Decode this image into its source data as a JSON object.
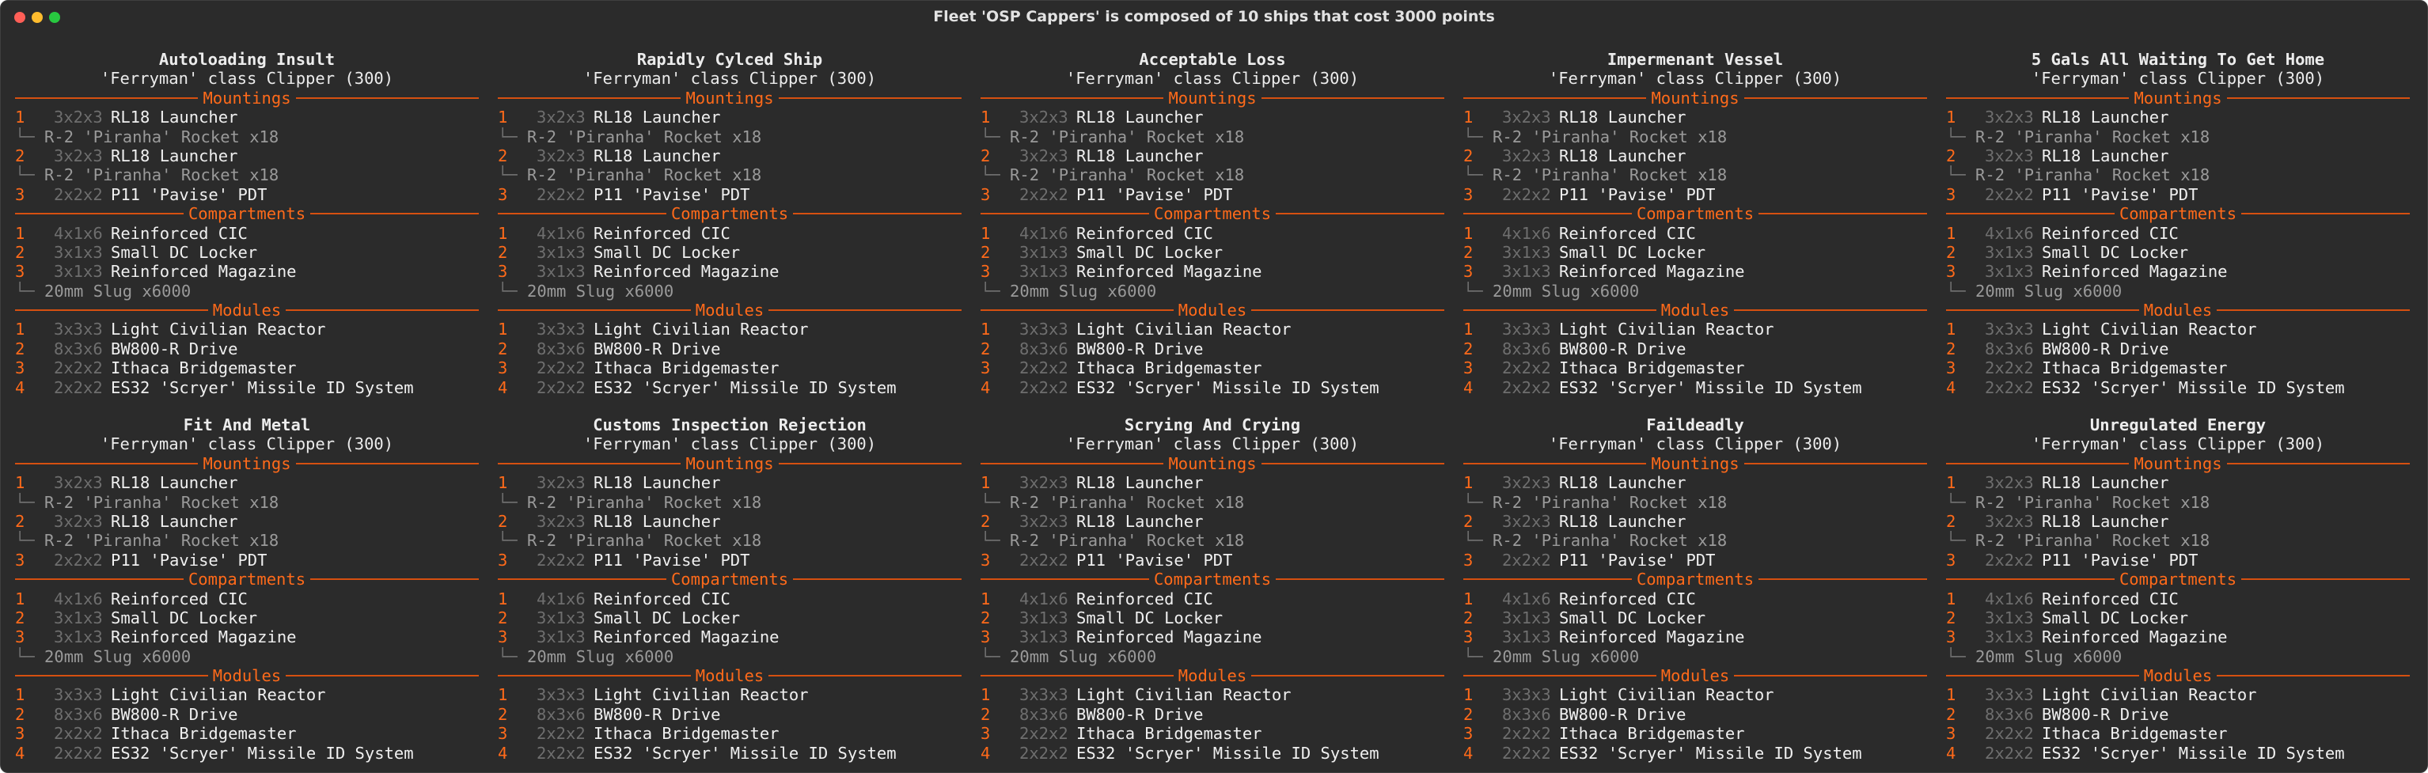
{
  "window": {
    "title": "Fleet 'OSP Cappers' is composed of 10 ships that cost 3000 points"
  },
  "ships": [
    {
      "name": "Autoloading Insult",
      "class": "'Ferryman' class Clipper (300)",
      "mountings_label": "Mountings",
      "mountings": [
        {
          "n": "1",
          "size": "3x2x3",
          "name": "RL18 Launcher",
          "sub": "R-2 'Piranha' Rocket x18"
        },
        {
          "n": "2",
          "size": "3x2x3",
          "name": "RL18 Launcher",
          "sub": "R-2 'Piranha' Rocket x18"
        },
        {
          "n": "3",
          "size": "2x2x2",
          "name": "P11 'Pavise' PDT"
        }
      ],
      "compartments_label": "Compartments",
      "compartments": [
        {
          "n": "1",
          "size": "4x1x6",
          "name": "Reinforced CIC"
        },
        {
          "n": "2",
          "size": "3x1x3",
          "name": "Small DC Locker"
        },
        {
          "n": "3",
          "size": "3x1x3",
          "name": "Reinforced Magazine",
          "sub": "20mm Slug x6000"
        }
      ],
      "modules_label": "Modules",
      "modules": [
        {
          "n": "1",
          "size": "3x3x3",
          "name": "Light Civilian Reactor"
        },
        {
          "n": "2",
          "size": "8x3x6",
          "name": "BW800-R Drive"
        },
        {
          "n": "3",
          "size": "2x2x2",
          "name": "Ithaca Bridgemaster"
        },
        {
          "n": "4",
          "size": "2x2x2",
          "name": "ES32 'Scryer' Missile ID System"
        }
      ]
    },
    {
      "name": "Rapidly Cylced Ship",
      "class": "'Ferryman' class Clipper (300)",
      "mountings_label": "Mountings",
      "mountings": [
        {
          "n": "1",
          "size": "3x2x3",
          "name": "RL18 Launcher",
          "sub": "R-2 'Piranha' Rocket x18"
        },
        {
          "n": "2",
          "size": "3x2x3",
          "name": "RL18 Launcher",
          "sub": "R-2 'Piranha' Rocket x18"
        },
        {
          "n": "3",
          "size": "2x2x2",
          "name": "P11 'Pavise' PDT"
        }
      ],
      "compartments_label": "Compartments",
      "compartments": [
        {
          "n": "1",
          "size": "4x1x6",
          "name": "Reinforced CIC"
        },
        {
          "n": "2",
          "size": "3x1x3",
          "name": "Small DC Locker"
        },
        {
          "n": "3",
          "size": "3x1x3",
          "name": "Reinforced Magazine",
          "sub": "20mm Slug x6000"
        }
      ],
      "modules_label": "Modules",
      "modules": [
        {
          "n": "1",
          "size": "3x3x3",
          "name": "Light Civilian Reactor"
        },
        {
          "n": "2",
          "size": "8x3x6",
          "name": "BW800-R Drive"
        },
        {
          "n": "3",
          "size": "2x2x2",
          "name": "Ithaca Bridgemaster"
        },
        {
          "n": "4",
          "size": "2x2x2",
          "name": "ES32 'Scryer' Missile ID System"
        }
      ]
    },
    {
      "name": "Acceptable Loss",
      "class": "'Ferryman' class Clipper (300)",
      "mountings_label": "Mountings",
      "mountings": [
        {
          "n": "1",
          "size": "3x2x3",
          "name": "RL18 Launcher",
          "sub": "R-2 'Piranha' Rocket x18"
        },
        {
          "n": "2",
          "size": "3x2x3",
          "name": "RL18 Launcher",
          "sub": "R-2 'Piranha' Rocket x18"
        },
        {
          "n": "3",
          "size": "2x2x2",
          "name": "P11 'Pavise' PDT"
        }
      ],
      "compartments_label": "Compartments",
      "compartments": [
        {
          "n": "1",
          "size": "4x1x6",
          "name": "Reinforced CIC"
        },
        {
          "n": "2",
          "size": "3x1x3",
          "name": "Small DC Locker"
        },
        {
          "n": "3",
          "size": "3x1x3",
          "name": "Reinforced Magazine",
          "sub": "20mm Slug x6000"
        }
      ],
      "modules_label": "Modules",
      "modules": [
        {
          "n": "1",
          "size": "3x3x3",
          "name": "Light Civilian Reactor"
        },
        {
          "n": "2",
          "size": "8x3x6",
          "name": "BW800-R Drive"
        },
        {
          "n": "3",
          "size": "2x2x2",
          "name": "Ithaca Bridgemaster"
        },
        {
          "n": "4",
          "size": "2x2x2",
          "name": "ES32 'Scryer' Missile ID System"
        }
      ]
    },
    {
      "name": "Impermenant Vessel",
      "class": "'Ferryman' class Clipper (300)",
      "mountings_label": "Mountings",
      "mountings": [
        {
          "n": "1",
          "size": "3x2x3",
          "name": "RL18 Launcher",
          "sub": "R-2 'Piranha' Rocket x18"
        },
        {
          "n": "2",
          "size": "3x2x3",
          "name": "RL18 Launcher",
          "sub": "R-2 'Piranha' Rocket x18"
        },
        {
          "n": "3",
          "size": "2x2x2",
          "name": "P11 'Pavise' PDT"
        }
      ],
      "compartments_label": "Compartments",
      "compartments": [
        {
          "n": "1",
          "size": "4x1x6",
          "name": "Reinforced CIC"
        },
        {
          "n": "2",
          "size": "3x1x3",
          "name": "Small DC Locker"
        },
        {
          "n": "3",
          "size": "3x1x3",
          "name": "Reinforced Magazine",
          "sub": "20mm Slug x6000"
        }
      ],
      "modules_label": "Modules",
      "modules": [
        {
          "n": "1",
          "size": "3x3x3",
          "name": "Light Civilian Reactor"
        },
        {
          "n": "2",
          "size": "8x3x6",
          "name": "BW800-R Drive"
        },
        {
          "n": "3",
          "size": "2x2x2",
          "name": "Ithaca Bridgemaster"
        },
        {
          "n": "4",
          "size": "2x2x2",
          "name": "ES32 'Scryer' Missile ID System"
        }
      ]
    },
    {
      "name": "5 Gals All Waiting To Get Home",
      "class": "'Ferryman' class Clipper (300)",
      "mountings_label": "Mountings",
      "mountings": [
        {
          "n": "1",
          "size": "3x2x3",
          "name": "RL18 Launcher",
          "sub": "R-2 'Piranha' Rocket x18"
        },
        {
          "n": "2",
          "size": "3x2x3",
          "name": "RL18 Launcher",
          "sub": "R-2 'Piranha' Rocket x18"
        },
        {
          "n": "3",
          "size": "2x2x2",
          "name": "P11 'Pavise' PDT"
        }
      ],
      "compartments_label": "Compartments",
      "compartments": [
        {
          "n": "1",
          "size": "4x1x6",
          "name": "Reinforced CIC"
        },
        {
          "n": "2",
          "size": "3x1x3",
          "name": "Small DC Locker"
        },
        {
          "n": "3",
          "size": "3x1x3",
          "name": "Reinforced Magazine",
          "sub": "20mm Slug x6000"
        }
      ],
      "modules_label": "Modules",
      "modules": [
        {
          "n": "1",
          "size": "3x3x3",
          "name": "Light Civilian Reactor"
        },
        {
          "n": "2",
          "size": "8x3x6",
          "name": "BW800-R Drive"
        },
        {
          "n": "3",
          "size": "2x2x2",
          "name": "Ithaca Bridgemaster"
        },
        {
          "n": "4",
          "size": "2x2x2",
          "name": "ES32 'Scryer' Missile ID System"
        }
      ]
    },
    {
      "name": "Fit And Metal",
      "class": "'Ferryman' class Clipper (300)",
      "mountings_label": "Mountings",
      "mountings": [
        {
          "n": "1",
          "size": "3x2x3",
          "name": "RL18 Launcher",
          "sub": "R-2 'Piranha' Rocket x18"
        },
        {
          "n": "2",
          "size": "3x2x3",
          "name": "RL18 Launcher",
          "sub": "R-2 'Piranha' Rocket x18"
        },
        {
          "n": "3",
          "size": "2x2x2",
          "name": "P11 'Pavise' PDT"
        }
      ],
      "compartments_label": "Compartments",
      "compartments": [
        {
          "n": "1",
          "size": "4x1x6",
          "name": "Reinforced CIC"
        },
        {
          "n": "2",
          "size": "3x1x3",
          "name": "Small DC Locker"
        },
        {
          "n": "3",
          "size": "3x1x3",
          "name": "Reinforced Magazine",
          "sub": "20mm Slug x6000"
        }
      ],
      "modules_label": "Modules",
      "modules": [
        {
          "n": "1",
          "size": "3x3x3",
          "name": "Light Civilian Reactor"
        },
        {
          "n": "2",
          "size": "8x3x6",
          "name": "BW800-R Drive"
        },
        {
          "n": "3",
          "size": "2x2x2",
          "name": "Ithaca Bridgemaster"
        },
        {
          "n": "4",
          "size": "2x2x2",
          "name": "ES32 'Scryer' Missile ID System"
        }
      ]
    },
    {
      "name": "Customs Inspection Rejection",
      "class": "'Ferryman' class Clipper (300)",
      "mountings_label": "Mountings",
      "mountings": [
        {
          "n": "1",
          "size": "3x2x3",
          "name": "RL18 Launcher",
          "sub": "R-2 'Piranha' Rocket x18"
        },
        {
          "n": "2",
          "size": "3x2x3",
          "name": "RL18 Launcher",
          "sub": "R-2 'Piranha' Rocket x18"
        },
        {
          "n": "3",
          "size": "2x2x2",
          "name": "P11 'Pavise' PDT"
        }
      ],
      "compartments_label": "Compartments",
      "compartments": [
        {
          "n": "1",
          "size": "4x1x6",
          "name": "Reinforced CIC"
        },
        {
          "n": "2",
          "size": "3x1x3",
          "name": "Small DC Locker"
        },
        {
          "n": "3",
          "size": "3x1x3",
          "name": "Reinforced Magazine",
          "sub": "20mm Slug x6000"
        }
      ],
      "modules_label": "Modules",
      "modules": [
        {
          "n": "1",
          "size": "3x3x3",
          "name": "Light Civilian Reactor"
        },
        {
          "n": "2",
          "size": "8x3x6",
          "name": "BW800-R Drive"
        },
        {
          "n": "3",
          "size": "2x2x2",
          "name": "Ithaca Bridgemaster"
        },
        {
          "n": "4",
          "size": "2x2x2",
          "name": "ES32 'Scryer' Missile ID System"
        }
      ]
    },
    {
      "name": "Scrying And Crying",
      "class": "'Ferryman' class Clipper (300)",
      "mountings_label": "Mountings",
      "mountings": [
        {
          "n": "1",
          "size": "3x2x3",
          "name": "RL18 Launcher",
          "sub": "R-2 'Piranha' Rocket x18"
        },
        {
          "n": "2",
          "size": "3x2x3",
          "name": "RL18 Launcher",
          "sub": "R-2 'Piranha' Rocket x18"
        },
        {
          "n": "3",
          "size": "2x2x2",
          "name": "P11 'Pavise' PDT"
        }
      ],
      "compartments_label": "Compartments",
      "compartments": [
        {
          "n": "1",
          "size": "4x1x6",
          "name": "Reinforced CIC"
        },
        {
          "n": "2",
          "size": "3x1x3",
          "name": "Small DC Locker"
        },
        {
          "n": "3",
          "size": "3x1x3",
          "name": "Reinforced Magazine",
          "sub": "20mm Slug x6000"
        }
      ],
      "modules_label": "Modules",
      "modules": [
        {
          "n": "1",
          "size": "3x3x3",
          "name": "Light Civilian Reactor"
        },
        {
          "n": "2",
          "size": "8x3x6",
          "name": "BW800-R Drive"
        },
        {
          "n": "3",
          "size": "2x2x2",
          "name": "Ithaca Bridgemaster"
        },
        {
          "n": "4",
          "size": "2x2x2",
          "name": "ES32 'Scryer' Missile ID System"
        }
      ]
    },
    {
      "name": "Faildeadly",
      "class": "'Ferryman' class Clipper (300)",
      "mountings_label": "Mountings",
      "mountings": [
        {
          "n": "1",
          "size": "3x2x3",
          "name": "RL18 Launcher",
          "sub": "R-2 'Piranha' Rocket x18"
        },
        {
          "n": "2",
          "size": "3x2x3",
          "name": "RL18 Launcher",
          "sub": "R-2 'Piranha' Rocket x18"
        },
        {
          "n": "3",
          "size": "2x2x2",
          "name": "P11 'Pavise' PDT"
        }
      ],
      "compartments_label": "Compartments",
      "compartments": [
        {
          "n": "1",
          "size": "4x1x6",
          "name": "Reinforced CIC"
        },
        {
          "n": "2",
          "size": "3x1x3",
          "name": "Small DC Locker"
        },
        {
          "n": "3",
          "size": "3x1x3",
          "name": "Reinforced Magazine",
          "sub": "20mm Slug x6000"
        }
      ],
      "modules_label": "Modules",
      "modules": [
        {
          "n": "1",
          "size": "3x3x3",
          "name": "Light Civilian Reactor"
        },
        {
          "n": "2",
          "size": "8x3x6",
          "name": "BW800-R Drive"
        },
        {
          "n": "3",
          "size": "2x2x2",
          "name": "Ithaca Bridgemaster"
        },
        {
          "n": "4",
          "size": "2x2x2",
          "name": "ES32 'Scryer' Missile ID System"
        }
      ]
    },
    {
      "name": "Unregulated Energy",
      "class": "'Ferryman' class Clipper (300)",
      "mountings_label": "Mountings",
      "mountings": [
        {
          "n": "1",
          "size": "3x2x3",
          "name": "RL18 Launcher",
          "sub": "R-2 'Piranha' Rocket x18"
        },
        {
          "n": "2",
          "size": "3x2x3",
          "name": "RL18 Launcher",
          "sub": "R-2 'Piranha' Rocket x18"
        },
        {
          "n": "3",
          "size": "2x2x2",
          "name": "P11 'Pavise' PDT"
        }
      ],
      "compartments_label": "Compartments",
      "compartments": [
        {
          "n": "1",
          "size": "4x1x6",
          "name": "Reinforced CIC"
        },
        {
          "n": "2",
          "size": "3x1x3",
          "name": "Small DC Locker"
        },
        {
          "n": "3",
          "size": "3x1x3",
          "name": "Reinforced Magazine",
          "sub": "20mm Slug x6000"
        }
      ],
      "modules_label": "Modules",
      "modules": [
        {
          "n": "1",
          "size": "3x3x3",
          "name": "Light Civilian Reactor"
        },
        {
          "n": "2",
          "size": "8x3x6",
          "name": "BW800-R Drive"
        },
        {
          "n": "3",
          "size": "2x2x2",
          "name": "Ithaca Bridgemaster"
        },
        {
          "n": "4",
          "size": "2x2x2",
          "name": "ES32 'Scryer' Missile ID System"
        }
      ]
    }
  ],
  "tree_glyph": "└─",
  "colors": {
    "background": "#2b2b2b",
    "accent": "#ff6a1a",
    "text": "#f0f0f0",
    "dim": "#6e6e6e"
  }
}
